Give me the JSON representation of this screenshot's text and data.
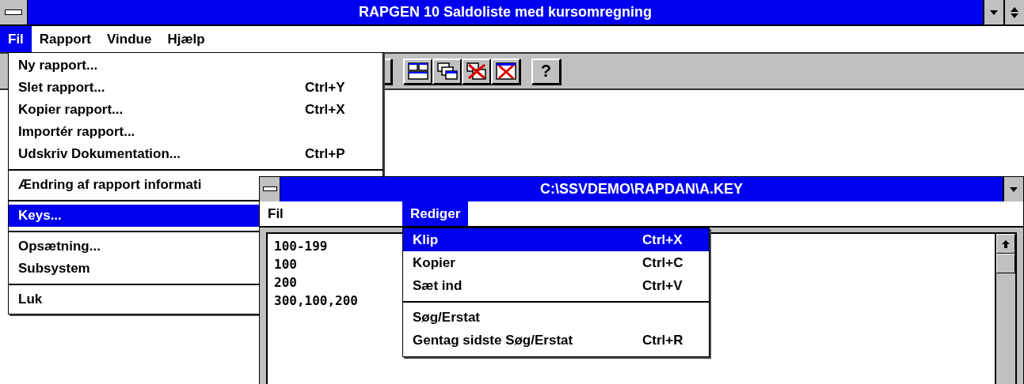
{
  "window": {
    "title": "RAPGEN 10 Saldoliste med kursomregning"
  },
  "menubar": [
    {
      "label": "Fil",
      "selected": true
    },
    {
      "label": "Rapport",
      "selected": false
    },
    {
      "label": "Vindue",
      "selected": false
    },
    {
      "label": "Hjælp",
      "selected": false
    }
  ],
  "toolbar": {
    "help_button": "?"
  },
  "file_menu": {
    "groups": [
      [
        {
          "label": "Ny rapport...",
          "selected": false
        },
        {
          "label": "Slet rapport...",
          "shortcut": "Ctrl+Y",
          "selected": false
        },
        {
          "label": "Kopier rapport...",
          "shortcut": "Ctrl+X",
          "selected": false
        },
        {
          "label": "Importér rapport...",
          "selected": false
        },
        {
          "label": "Udskriv Dokumentation...",
          "shortcut": "Ctrl+P",
          "selected": false
        }
      ],
      [
        {
          "label": "Ændring af rapport informati",
          "selected": false
        }
      ],
      [
        {
          "label": "Keys...",
          "selected": true
        }
      ],
      [
        {
          "label": "Opsætning...",
          "selected": false
        },
        {
          "label": "Subsystem",
          "selected": false
        }
      ],
      [
        {
          "label": "Luk",
          "selected": false
        }
      ]
    ]
  },
  "child_window": {
    "title": "C:\\SSVDEMO\\RAPDAN\\A.KEY",
    "menubar": [
      {
        "label": "Fil",
        "selected": false
      },
      {
        "label": "Rediger",
        "selected": true
      }
    ],
    "lines": [
      "100-199",
      "100",
      "200",
      "300,100,200"
    ]
  },
  "edit_menu": {
    "groups": [
      [
        {
          "label": "Klip",
          "shortcut": "Ctrl+X",
          "selected": true
        },
        {
          "label": "Kopier",
          "shortcut": "Ctrl+C",
          "selected": false
        },
        {
          "label": "Sæt ind",
          "shortcut": "Ctrl+V",
          "selected": false
        }
      ],
      [
        {
          "label": "Søg/Erstat",
          "selected": false
        },
        {
          "label": "Gentag sidste Søg/Erstat",
          "shortcut": "Ctrl+R",
          "selected": false
        }
      ]
    ]
  }
}
